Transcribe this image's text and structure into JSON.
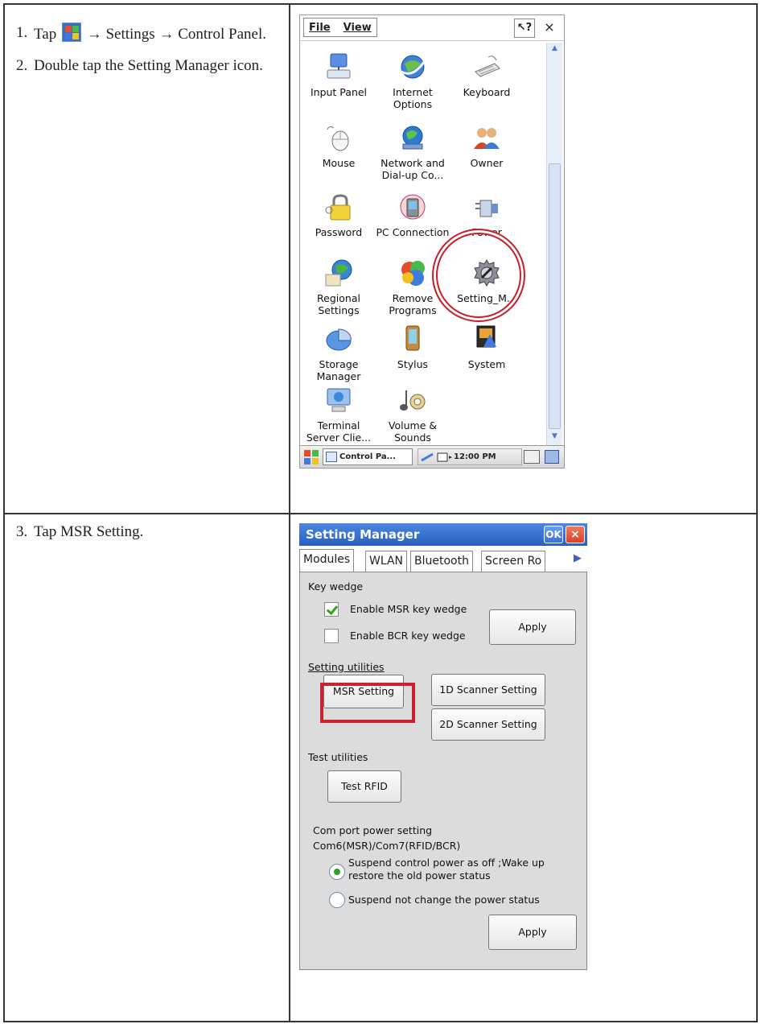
{
  "steps_row1": [
    {
      "num": "1.",
      "before": "Tap",
      "after": "→ Settings → Control Panel."
    },
    {
      "num": "2.",
      "text": "Double tap the Setting Manager icon."
    }
  ],
  "steps_row2": [
    {
      "num": "3.",
      "text": "Tap MSR Setting."
    }
  ],
  "control_panel": {
    "menu": [
      "File",
      "View"
    ],
    "help_label": "?",
    "close_label": "×",
    "icons": [
      {
        "label": "Input Panel",
        "icon": "input-panel-icon"
      },
      {
        "label": "Internet Options",
        "icon": "internet-options-icon"
      },
      {
        "label": "Keyboard",
        "icon": "keyboard-icon"
      },
      {
        "label": "Mouse",
        "icon": "mouse-icon"
      },
      {
        "label": "Network and Dial-up Co...",
        "icon": "network-icon"
      },
      {
        "label": "Owner",
        "icon": "owner-icon"
      },
      {
        "label": "Password",
        "icon": "password-icon"
      },
      {
        "label": "PC Connection",
        "icon": "pc-connection-icon"
      },
      {
        "label": "Power",
        "icon": "power-icon"
      },
      {
        "label": "Regional Settings",
        "icon": "regional-settings-icon"
      },
      {
        "label": "Remove Programs",
        "icon": "remove-programs-icon"
      },
      {
        "label": "Setting_M...",
        "icon": "setting-manager-icon"
      },
      {
        "label": "Storage Manager",
        "icon": "storage-manager-icon"
      },
      {
        "label": "Stylus",
        "icon": "stylus-icon"
      },
      {
        "label": "System",
        "icon": "system-icon"
      },
      {
        "label": "Terminal Server Clie...",
        "icon": "terminal-server-icon"
      },
      {
        "label": "Volume & Sounds",
        "icon": "volume-sounds-icon"
      }
    ],
    "taskbar": {
      "task_label": "Control Pa...",
      "clock": "12:00 PM"
    }
  },
  "setting_manager": {
    "title": "Setting Manager",
    "ok_label": "OK",
    "close_label": "×",
    "tabs": [
      "Modules",
      "WLAN",
      "Bluetooth",
      "Screen Ro"
    ],
    "key_wedge_heading": "Key wedge",
    "enable_msr_label": "Enable MSR key wedge",
    "enable_msr_checked": true,
    "enable_bcr_label": "Enable BCR key wedge",
    "enable_bcr_checked": false,
    "apply_label": "Apply",
    "setting_utilities_heading": "Setting utilities",
    "msr_setting_label": "MSR Setting",
    "scanner_1d_label": "1D Scanner Setting",
    "scanner_2d_label": "2D Scanner Setting",
    "test_utilities_heading": "Test utilities",
    "test_rfid_label": "Test RFID",
    "com_port_heading": "Com port power setting",
    "com_port_sub": "Com6(MSR)/Com7(RFID/BCR)",
    "radio_suspend_off_line1": "Suspend control power as off ;Wake up",
    "radio_suspend_off_line2": "restore the old power status",
    "radio_suspend_nochange": "Suspend not change the power status",
    "selected_radio": "suspend-off",
    "apply2_label": "Apply"
  },
  "colors": {
    "highlight_red": "#c8202a",
    "title_blue": "#2a5fc0",
    "check_green": "#2fa11f"
  }
}
